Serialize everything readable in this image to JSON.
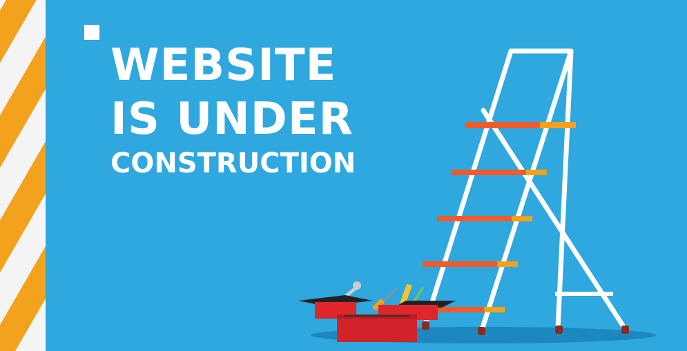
{
  "headline": {
    "line1": "WEBSITE",
    "line2": "IS UNDER",
    "line3": "CONSTRUCTION"
  },
  "colors": {
    "background": "#2ea8df",
    "stripe_orange": "#f3a21e",
    "stripe_white": "#f4f4f4",
    "ladder": "#ffffff",
    "rung_orange": "#f15a2b",
    "rung_yellow": "#f7a11a",
    "toolbox_red": "#e0262a",
    "shadow": "#1d87c0"
  },
  "icons": [
    "ladder-icon",
    "toolbox-icon",
    "wrench-icon",
    "screwdriver-icon",
    "ruler-icon"
  ]
}
